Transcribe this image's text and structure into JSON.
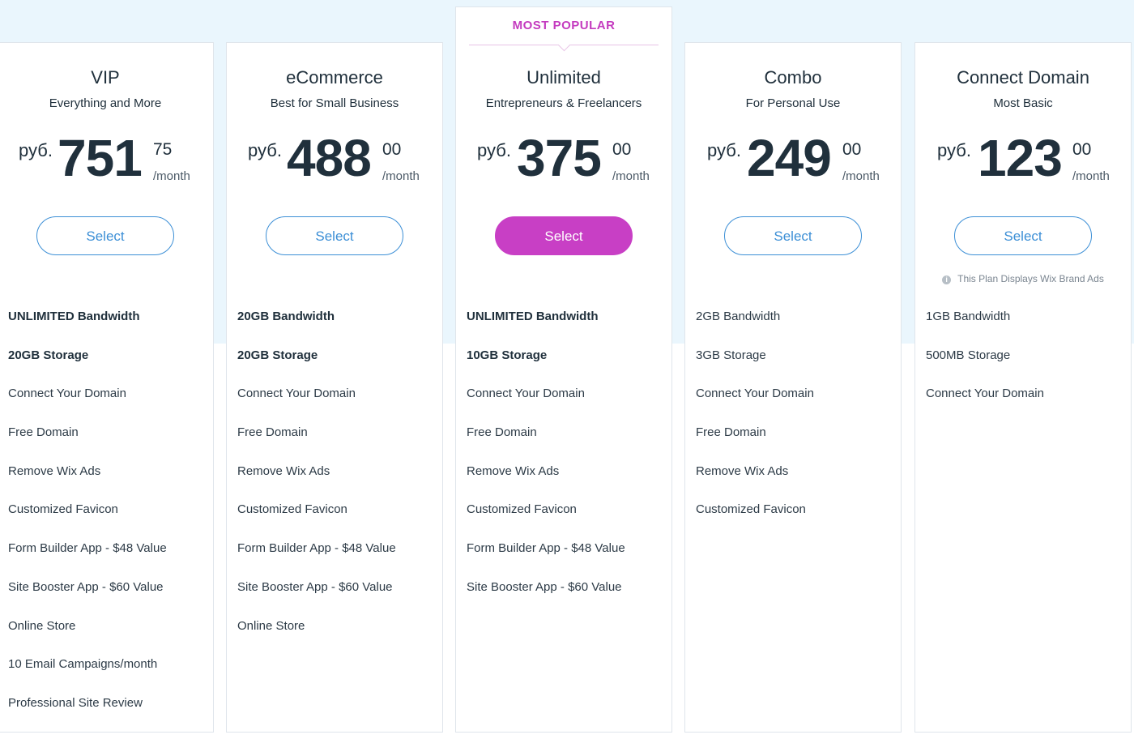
{
  "popular_label": "MOST POPULAR",
  "ads_note": "This Plan Displays Wix Brand Ads",
  "colors": {
    "accent": "#c83fc5",
    "button_outline": "#3c8fd6",
    "background_band": "#eaf6fd"
  },
  "plans": [
    {
      "name": "VIP",
      "tagline": "Everything and More",
      "currency": "руб.",
      "amount": "751",
      "cents": "75",
      "period": "/month",
      "button": "Select",
      "features": [
        {
          "text": "UNLIMITED Bandwidth",
          "bold": true
        },
        {
          "text": "20GB Storage",
          "bold": true
        },
        {
          "text": "Connect Your Domain"
        },
        {
          "text": "Free Domain"
        },
        {
          "text": "Remove Wix Ads"
        },
        {
          "text": "Customized Favicon"
        },
        {
          "text": "Form Builder App - $48 Value"
        },
        {
          "text": "Site Booster App - $60 Value"
        },
        {
          "text": "Online Store"
        },
        {
          "text": "10 Email Campaigns/month"
        },
        {
          "text": "Professional Site Review"
        }
      ]
    },
    {
      "name": "eCommerce",
      "tagline": "Best for Small Business",
      "currency": "руб.",
      "amount": "488",
      "cents": "00",
      "period": "/month",
      "button": "Select",
      "features": [
        {
          "text": "20GB Bandwidth",
          "bold": true
        },
        {
          "text": "20GB Storage",
          "bold": true
        },
        {
          "text": "Connect Your Domain"
        },
        {
          "text": "Free Domain"
        },
        {
          "text": "Remove Wix Ads"
        },
        {
          "text": "Customized Favicon"
        },
        {
          "text": "Form Builder App - $48 Value"
        },
        {
          "text": "Site Booster App - $60 Value"
        },
        {
          "text": "Online Store"
        }
      ]
    },
    {
      "name": "Unlimited",
      "tagline": "Entrepreneurs & Freelancers",
      "currency": "руб.",
      "amount": "375",
      "cents": "00",
      "period": "/month",
      "button": "Select",
      "popular": true,
      "features": [
        {
          "text": "UNLIMITED Bandwidth",
          "bold": true
        },
        {
          "text": "10GB Storage",
          "bold": true
        },
        {
          "text": "Connect Your Domain"
        },
        {
          "text": "Free Domain"
        },
        {
          "text": "Remove Wix Ads"
        },
        {
          "text": "Customized Favicon"
        },
        {
          "text": "Form Builder App - $48 Value"
        },
        {
          "text": "Site Booster App - $60 Value"
        }
      ]
    },
    {
      "name": "Combo",
      "tagline": "For Personal Use",
      "currency": "руб.",
      "amount": "249",
      "cents": "00",
      "period": "/month",
      "button": "Select",
      "features": [
        {
          "text": "2GB Bandwidth"
        },
        {
          "text": "3GB Storage"
        },
        {
          "text": "Connect Your Domain"
        },
        {
          "text": "Free Domain"
        },
        {
          "text": "Remove Wix Ads"
        },
        {
          "text": "Customized Favicon"
        }
      ]
    },
    {
      "name": "Connect Domain",
      "tagline": "Most Basic",
      "currency": "руб.",
      "amount": "123",
      "cents": "00",
      "period": "/month",
      "button": "Select",
      "shows_ads_note": true,
      "features": [
        {
          "text": "1GB Bandwidth"
        },
        {
          "text": "500MB Storage"
        },
        {
          "text": "Connect Your Domain"
        }
      ]
    }
  ]
}
